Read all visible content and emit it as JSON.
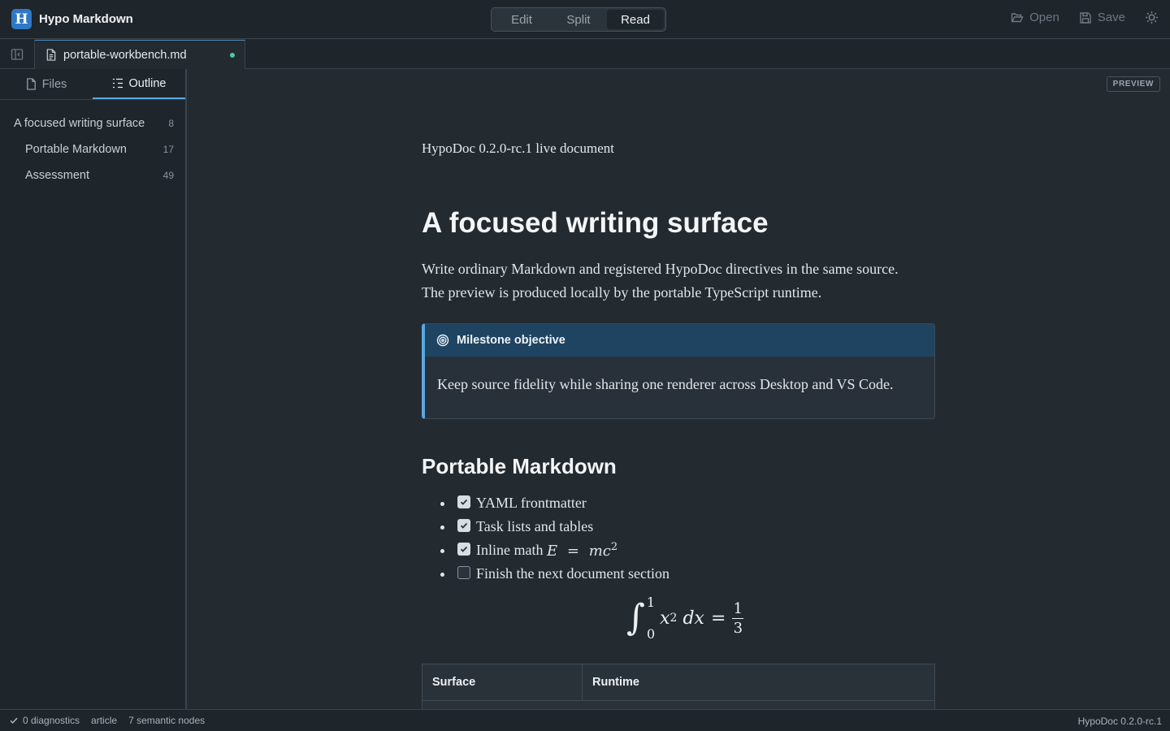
{
  "app": {
    "logo_letter": "H",
    "name": "Hypo Markdown"
  },
  "modes": [
    {
      "label": "Edit",
      "active": false
    },
    {
      "label": "Split",
      "active": false
    },
    {
      "label": "Read",
      "active": true
    }
  ],
  "actions": {
    "open_label": "Open",
    "save_label": "Save",
    "theme_icon": "sun-icon"
  },
  "tab": {
    "filename": "portable-workbench.md",
    "dirty": true
  },
  "sidebar": {
    "tabs": [
      {
        "label": "Files",
        "icon": "file-icon",
        "active": false
      },
      {
        "label": "Outline",
        "icon": "outline-icon",
        "active": true
      }
    ],
    "outline": [
      {
        "title": "A focused writing surface",
        "line": "8",
        "level": 1
      },
      {
        "title": "Portable Markdown",
        "line": "17",
        "level": 2
      },
      {
        "title": "Assessment",
        "line": "49",
        "level": 2
      }
    ]
  },
  "preview": {
    "badge": "PREVIEW",
    "meta": "HypoDoc 0.2.0-rc.1 live document",
    "h1": "A focused writing surface",
    "paragraph_line1": "Write ordinary Markdown and registered HypoDoc directives in the same source.",
    "paragraph_line2": "The preview is produced locally by the portable TypeScript runtime.",
    "callout": {
      "title": "Milestone objective",
      "body": "Keep source fidelity while sharing one renderer across Desktop and VS Code."
    },
    "h2": "Portable Markdown",
    "tasks": [
      {
        "text": "YAML frontmatter",
        "checked": true
      },
      {
        "text": "Task lists and tables",
        "checked": true
      },
      {
        "text": "Inline math ",
        "checked": true
      },
      {
        "text": "Finish the next document section",
        "checked": false
      }
    ],
    "inline_math": {
      "lhs": "E",
      "eq": "=",
      "rhs": "mc",
      "exp": "2"
    },
    "display_math": {
      "upper": "1",
      "lower": "0",
      "var": "x",
      "exp": "2",
      "dx": "dx",
      "eq": "=",
      "num": "1",
      "den": "3"
    },
    "table_headers": [
      "Surface",
      "Runtime"
    ]
  },
  "status": {
    "diagnostics": "0 diagnostics",
    "kind": "article",
    "nodes": "7 semantic nodes",
    "version": "HypoDoc 0.2.0-rc.1"
  },
  "colors": {
    "accent": "#5aa7e0",
    "brand": "#2f79c4",
    "dirty_dot": "#4cc9a8",
    "callout_header": "#1f4462"
  }
}
